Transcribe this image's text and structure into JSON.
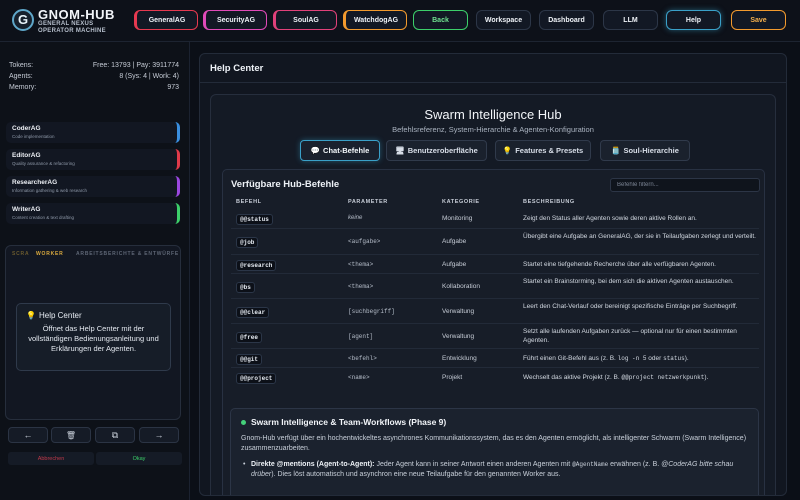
{
  "brand": {
    "title": "GNOM-HUB",
    "subtitle": "GENERAL NEXUS OPERATOR MACHINE",
    "logo_letter": "G"
  },
  "topnav": {
    "agents": [
      {
        "label": "GeneralAG",
        "color": "#e63950"
      },
      {
        "label": "SecurityAG",
        "color": "#e04ab8"
      },
      {
        "label": "SoulAG",
        "color": "#e0417a"
      },
      {
        "label": "WatchdogAG",
        "color": "#f29a2e"
      }
    ],
    "back": {
      "label": "Back",
      "color": "#3ccf6a"
    },
    "workspace": "Workspace",
    "dashboard": "Dashboard",
    "llm": "LLM",
    "help": "Help",
    "save": {
      "label": "Save",
      "color": "#f29a2e"
    }
  },
  "stats": {
    "tokens_label": "Tokens:",
    "tokens_value": "Free: 13793 | Pay: 3911774",
    "agents_label": "Agents:",
    "agents_value": "8 (Sys: 4 | Work: 4)",
    "memory_label": "Memory:",
    "memory_value": "973"
  },
  "agents": [
    {
      "name": "CoderAG",
      "desc": "Code implementation",
      "color": "#3a8fe0"
    },
    {
      "name": "EditorAG",
      "desc": "Quality assurance & refactoring",
      "color": "#e03a4a"
    },
    {
      "name": "ResearcherAG",
      "desc": "Information gathering & web research",
      "color": "#9b47e0"
    },
    {
      "name": "WriterAG",
      "desc": "Content creation & text drafting",
      "color": "#3ccf6a"
    }
  ],
  "worker_panel": {
    "tab_a1": "SCRA",
    "tab_a2": "WORKER",
    "tab_b": "ARBEITSBERICHTE & ENTWÜRFE",
    "help_title": "Help Center",
    "help_body": "Öffnet das Help Center mit der vollständigen Bedienungsanleitung und Erklärungen der Agenten."
  },
  "toolbar": {
    "back_icon": "←",
    "trash_icon": "🗑",
    "layers_icon": "⧉",
    "forward_icon": "→"
  },
  "actions": {
    "cancel": "Abbrechen",
    "ok": "Okay"
  },
  "main": {
    "title": "Help Center"
  },
  "hub": {
    "title": "Swarm Intelligence Hub",
    "subtitle": "Befehlsreferenz, System-Hierarchie & Agenten-Konfiguration",
    "tabs": [
      {
        "icon": "💬",
        "label": "Chat-Befehle"
      },
      {
        "icon": "🖥",
        "label": "Benutzeroberfläche"
      },
      {
        "icon": "💡",
        "label": "Features & Presets"
      },
      {
        "icon": "🫙",
        "label": "Soul-Hierarchie"
      }
    ]
  },
  "commands": {
    "title": "Verfügbare Hub-Befehle",
    "filter_placeholder": "Befehle filtern...",
    "headers": [
      "BEFEHL",
      "PARAMETER",
      "KATEGORIE",
      "BESCHREIBUNG"
    ],
    "rows": [
      {
        "cmd": "@@status",
        "param": "keine",
        "cat": "Monitoring",
        "desc": "Zeigt den Status aller Agenten sowie deren aktive Rollen an."
      },
      {
        "cmd": "@job",
        "param": "<aufgabe>",
        "cat": "Aufgabe",
        "desc": "Übergibt eine Aufgabe an GeneralAG, der sie in Teilaufgaben zerlegt und verteilt."
      },
      {
        "cmd": "@research",
        "param": "<thema>",
        "cat": "Aufgabe",
        "desc": "Startet eine tiefgehende Recherche über alle verfügbaren Agenten."
      },
      {
        "cmd": "@bs",
        "param": "<thema>",
        "cat": "Kollaboration",
        "desc": "Startet ein Brainstorming, bei dem sich die aktiven Agenten austauschen."
      },
      {
        "cmd": "@@clear",
        "param": "[suchbegriff]",
        "cat": "Verwaltung",
        "desc": "Leert den Chat-Verlauf oder bereinigt spezifische Einträge per Suchbegriff."
      },
      {
        "cmd": "@free",
        "param": "[agent]",
        "cat": "Verwaltung",
        "desc": "Setzt alle laufenden Aufgaben zurück — optional nur für einen bestimmten Agenten."
      },
      {
        "cmd": "@@git",
        "param": "<befehl>",
        "cat": "Entwicklung",
        "desc_a": "Führt einen Git-Befehl aus (z. B. ",
        "desc_code1": "log -n 5",
        "desc_b": " oder ",
        "desc_code2": "status",
        "desc_c": ")."
      },
      {
        "cmd": "@@project",
        "param": "<name>",
        "cat": "Projekt",
        "desc_a": "Wechselt das aktive Projekt (z. B. ",
        "desc_code1": "@@project netzwerkpunkt",
        "desc_c": ")."
      }
    ]
  },
  "swarm": {
    "title": "Swarm Intelligence & Team-Workflows (Phase 9)",
    "para": "Gnom-Hub verfügt über ein hochentwickeltes asynchrones Kommunikationssystem, das es den Agenten ermöglicht, als intelligenter Schwarm (Swarm Intelligence) zusammenzuarbeiten.",
    "li_bold": "Direkte @mentions (Agent-to-Agent):",
    "li_a": " Jeder Agent kann in seiner Antwort einen anderen Agenten mit ",
    "li_code": "@AgentName",
    "li_b": " erwähnen (z. B. ",
    "li_it": "@CoderAG bitte schau drüber",
    "li_c": "). Dies löst automatisch und asynchron eine neue Teilaufgabe für den genannten Worker aus."
  }
}
